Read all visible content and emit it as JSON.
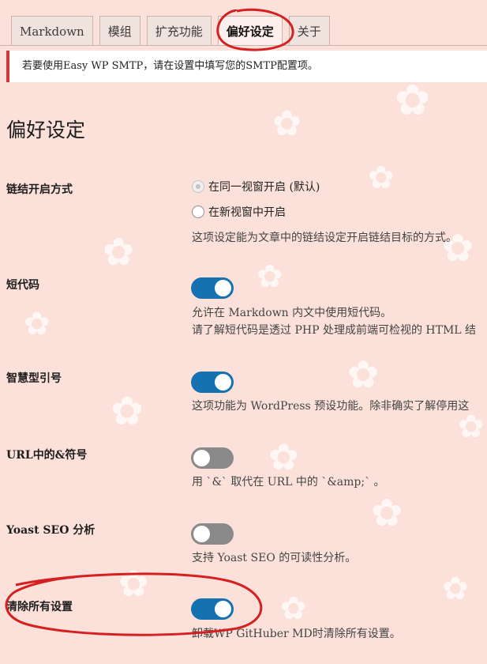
{
  "tabs": [
    {
      "label": "Markdown",
      "active": false
    },
    {
      "label": "模组",
      "active": false
    },
    {
      "label": "扩充功能",
      "active": false
    },
    {
      "label": "偏好设定",
      "active": true
    },
    {
      "label": "关于",
      "active": false
    }
  ],
  "notice": "若要使用Easy WP SMTP，请在设置中填写您的SMTP配置项。",
  "page_title": "偏好设定",
  "settings": {
    "link_open": {
      "label": "链结开启方式",
      "options": [
        {
          "label": "在同一视窗开启 (默认)",
          "checked": true
        },
        {
          "label": "在新视窗中开启",
          "checked": false
        }
      ],
      "desc": "这项设定能为文章中的链结设定开启链结目标的方式。"
    },
    "shortcode": {
      "label": "短代码",
      "enabled": true,
      "desc1": "允许在 Markdown 内文中使用短代码。",
      "desc2": "请了解短代码是透过 PHP 处理成前端可检视的 HTML 结"
    },
    "smart_quotes": {
      "label": "智慧型引号",
      "enabled": true,
      "desc": "这项功能为 WordPress 预设功能。除非确实了解停用这"
    },
    "url_amp": {
      "label": "URL中的&符号",
      "enabled": false,
      "desc": "用 `&` 取代在 URL 中的 `&amp;` 。"
    },
    "yoast": {
      "label": "Yoast SEO 分析",
      "enabled": false,
      "desc": "支持 Yoast SEO 的可读性分析。"
    },
    "clear_all": {
      "label": "清除所有设置",
      "enabled": true,
      "desc": "卸载WP GitHuber MD时清除所有设置。"
    }
  },
  "colors": {
    "toggle_on": "#1671b0",
    "toggle_off": "#8a8a8a",
    "annotation": "#d42020",
    "notice_border": "#d63638"
  }
}
